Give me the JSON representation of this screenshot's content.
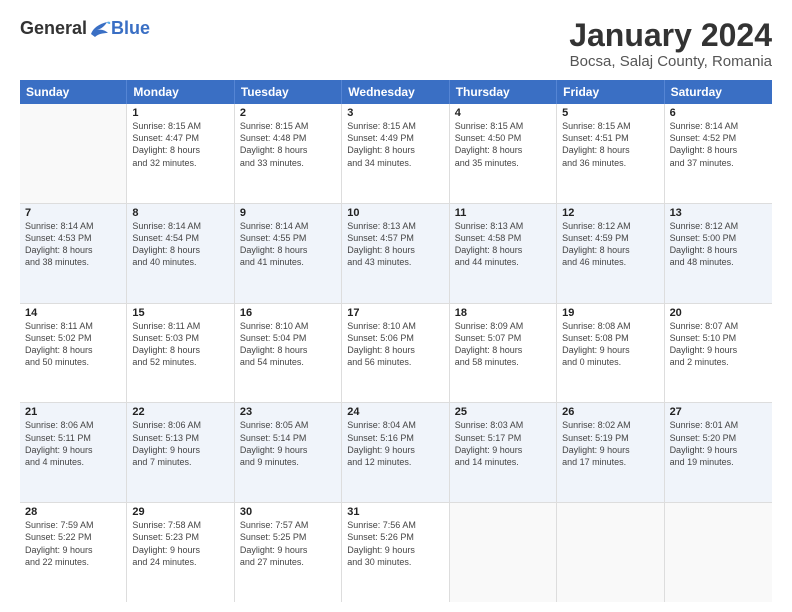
{
  "logo": {
    "general": "General",
    "blue": "Blue"
  },
  "title": "January 2024",
  "subtitle": "Bocsa, Salaj County, Romania",
  "days": [
    "Sunday",
    "Monday",
    "Tuesday",
    "Wednesday",
    "Thursday",
    "Friday",
    "Saturday"
  ],
  "rows": [
    [
      {
        "num": "",
        "lines": [],
        "empty": true
      },
      {
        "num": "1",
        "lines": [
          "Sunrise: 8:15 AM",
          "Sunset: 4:47 PM",
          "Daylight: 8 hours",
          "and 32 minutes."
        ]
      },
      {
        "num": "2",
        "lines": [
          "Sunrise: 8:15 AM",
          "Sunset: 4:48 PM",
          "Daylight: 8 hours",
          "and 33 minutes."
        ]
      },
      {
        "num": "3",
        "lines": [
          "Sunrise: 8:15 AM",
          "Sunset: 4:49 PM",
          "Daylight: 8 hours",
          "and 34 minutes."
        ]
      },
      {
        "num": "4",
        "lines": [
          "Sunrise: 8:15 AM",
          "Sunset: 4:50 PM",
          "Daylight: 8 hours",
          "and 35 minutes."
        ]
      },
      {
        "num": "5",
        "lines": [
          "Sunrise: 8:15 AM",
          "Sunset: 4:51 PM",
          "Daylight: 8 hours",
          "and 36 minutes."
        ]
      },
      {
        "num": "6",
        "lines": [
          "Sunrise: 8:14 AM",
          "Sunset: 4:52 PM",
          "Daylight: 8 hours",
          "and 37 minutes."
        ]
      }
    ],
    [
      {
        "num": "7",
        "lines": [
          "Sunrise: 8:14 AM",
          "Sunset: 4:53 PM",
          "Daylight: 8 hours",
          "and 38 minutes."
        ]
      },
      {
        "num": "8",
        "lines": [
          "Sunrise: 8:14 AM",
          "Sunset: 4:54 PM",
          "Daylight: 8 hours",
          "and 40 minutes."
        ]
      },
      {
        "num": "9",
        "lines": [
          "Sunrise: 8:14 AM",
          "Sunset: 4:55 PM",
          "Daylight: 8 hours",
          "and 41 minutes."
        ]
      },
      {
        "num": "10",
        "lines": [
          "Sunrise: 8:13 AM",
          "Sunset: 4:57 PM",
          "Daylight: 8 hours",
          "and 43 minutes."
        ]
      },
      {
        "num": "11",
        "lines": [
          "Sunrise: 8:13 AM",
          "Sunset: 4:58 PM",
          "Daylight: 8 hours",
          "and 44 minutes."
        ]
      },
      {
        "num": "12",
        "lines": [
          "Sunrise: 8:12 AM",
          "Sunset: 4:59 PM",
          "Daylight: 8 hours",
          "and 46 minutes."
        ]
      },
      {
        "num": "13",
        "lines": [
          "Sunrise: 8:12 AM",
          "Sunset: 5:00 PM",
          "Daylight: 8 hours",
          "and 48 minutes."
        ]
      }
    ],
    [
      {
        "num": "14",
        "lines": [
          "Sunrise: 8:11 AM",
          "Sunset: 5:02 PM",
          "Daylight: 8 hours",
          "and 50 minutes."
        ]
      },
      {
        "num": "15",
        "lines": [
          "Sunrise: 8:11 AM",
          "Sunset: 5:03 PM",
          "Daylight: 8 hours",
          "and 52 minutes."
        ]
      },
      {
        "num": "16",
        "lines": [
          "Sunrise: 8:10 AM",
          "Sunset: 5:04 PM",
          "Daylight: 8 hours",
          "and 54 minutes."
        ]
      },
      {
        "num": "17",
        "lines": [
          "Sunrise: 8:10 AM",
          "Sunset: 5:06 PM",
          "Daylight: 8 hours",
          "and 56 minutes."
        ]
      },
      {
        "num": "18",
        "lines": [
          "Sunrise: 8:09 AM",
          "Sunset: 5:07 PM",
          "Daylight: 8 hours",
          "and 58 minutes."
        ]
      },
      {
        "num": "19",
        "lines": [
          "Sunrise: 8:08 AM",
          "Sunset: 5:08 PM",
          "Daylight: 9 hours",
          "and 0 minutes."
        ]
      },
      {
        "num": "20",
        "lines": [
          "Sunrise: 8:07 AM",
          "Sunset: 5:10 PM",
          "Daylight: 9 hours",
          "and 2 minutes."
        ]
      }
    ],
    [
      {
        "num": "21",
        "lines": [
          "Sunrise: 8:06 AM",
          "Sunset: 5:11 PM",
          "Daylight: 9 hours",
          "and 4 minutes."
        ]
      },
      {
        "num": "22",
        "lines": [
          "Sunrise: 8:06 AM",
          "Sunset: 5:13 PM",
          "Daylight: 9 hours",
          "and 7 minutes."
        ]
      },
      {
        "num": "23",
        "lines": [
          "Sunrise: 8:05 AM",
          "Sunset: 5:14 PM",
          "Daylight: 9 hours",
          "and 9 minutes."
        ]
      },
      {
        "num": "24",
        "lines": [
          "Sunrise: 8:04 AM",
          "Sunset: 5:16 PM",
          "Daylight: 9 hours",
          "and 12 minutes."
        ]
      },
      {
        "num": "25",
        "lines": [
          "Sunrise: 8:03 AM",
          "Sunset: 5:17 PM",
          "Daylight: 9 hours",
          "and 14 minutes."
        ]
      },
      {
        "num": "26",
        "lines": [
          "Sunrise: 8:02 AM",
          "Sunset: 5:19 PM",
          "Daylight: 9 hours",
          "and 17 minutes."
        ]
      },
      {
        "num": "27",
        "lines": [
          "Sunrise: 8:01 AM",
          "Sunset: 5:20 PM",
          "Daylight: 9 hours",
          "and 19 minutes."
        ]
      }
    ],
    [
      {
        "num": "28",
        "lines": [
          "Sunrise: 7:59 AM",
          "Sunset: 5:22 PM",
          "Daylight: 9 hours",
          "and 22 minutes."
        ]
      },
      {
        "num": "29",
        "lines": [
          "Sunrise: 7:58 AM",
          "Sunset: 5:23 PM",
          "Daylight: 9 hours",
          "and 24 minutes."
        ]
      },
      {
        "num": "30",
        "lines": [
          "Sunrise: 7:57 AM",
          "Sunset: 5:25 PM",
          "Daylight: 9 hours",
          "and 27 minutes."
        ]
      },
      {
        "num": "31",
        "lines": [
          "Sunrise: 7:56 AM",
          "Sunset: 5:26 PM",
          "Daylight: 9 hours",
          "and 30 minutes."
        ]
      },
      {
        "num": "",
        "lines": [],
        "empty": true
      },
      {
        "num": "",
        "lines": [],
        "empty": true
      },
      {
        "num": "",
        "lines": [],
        "empty": true
      }
    ]
  ]
}
